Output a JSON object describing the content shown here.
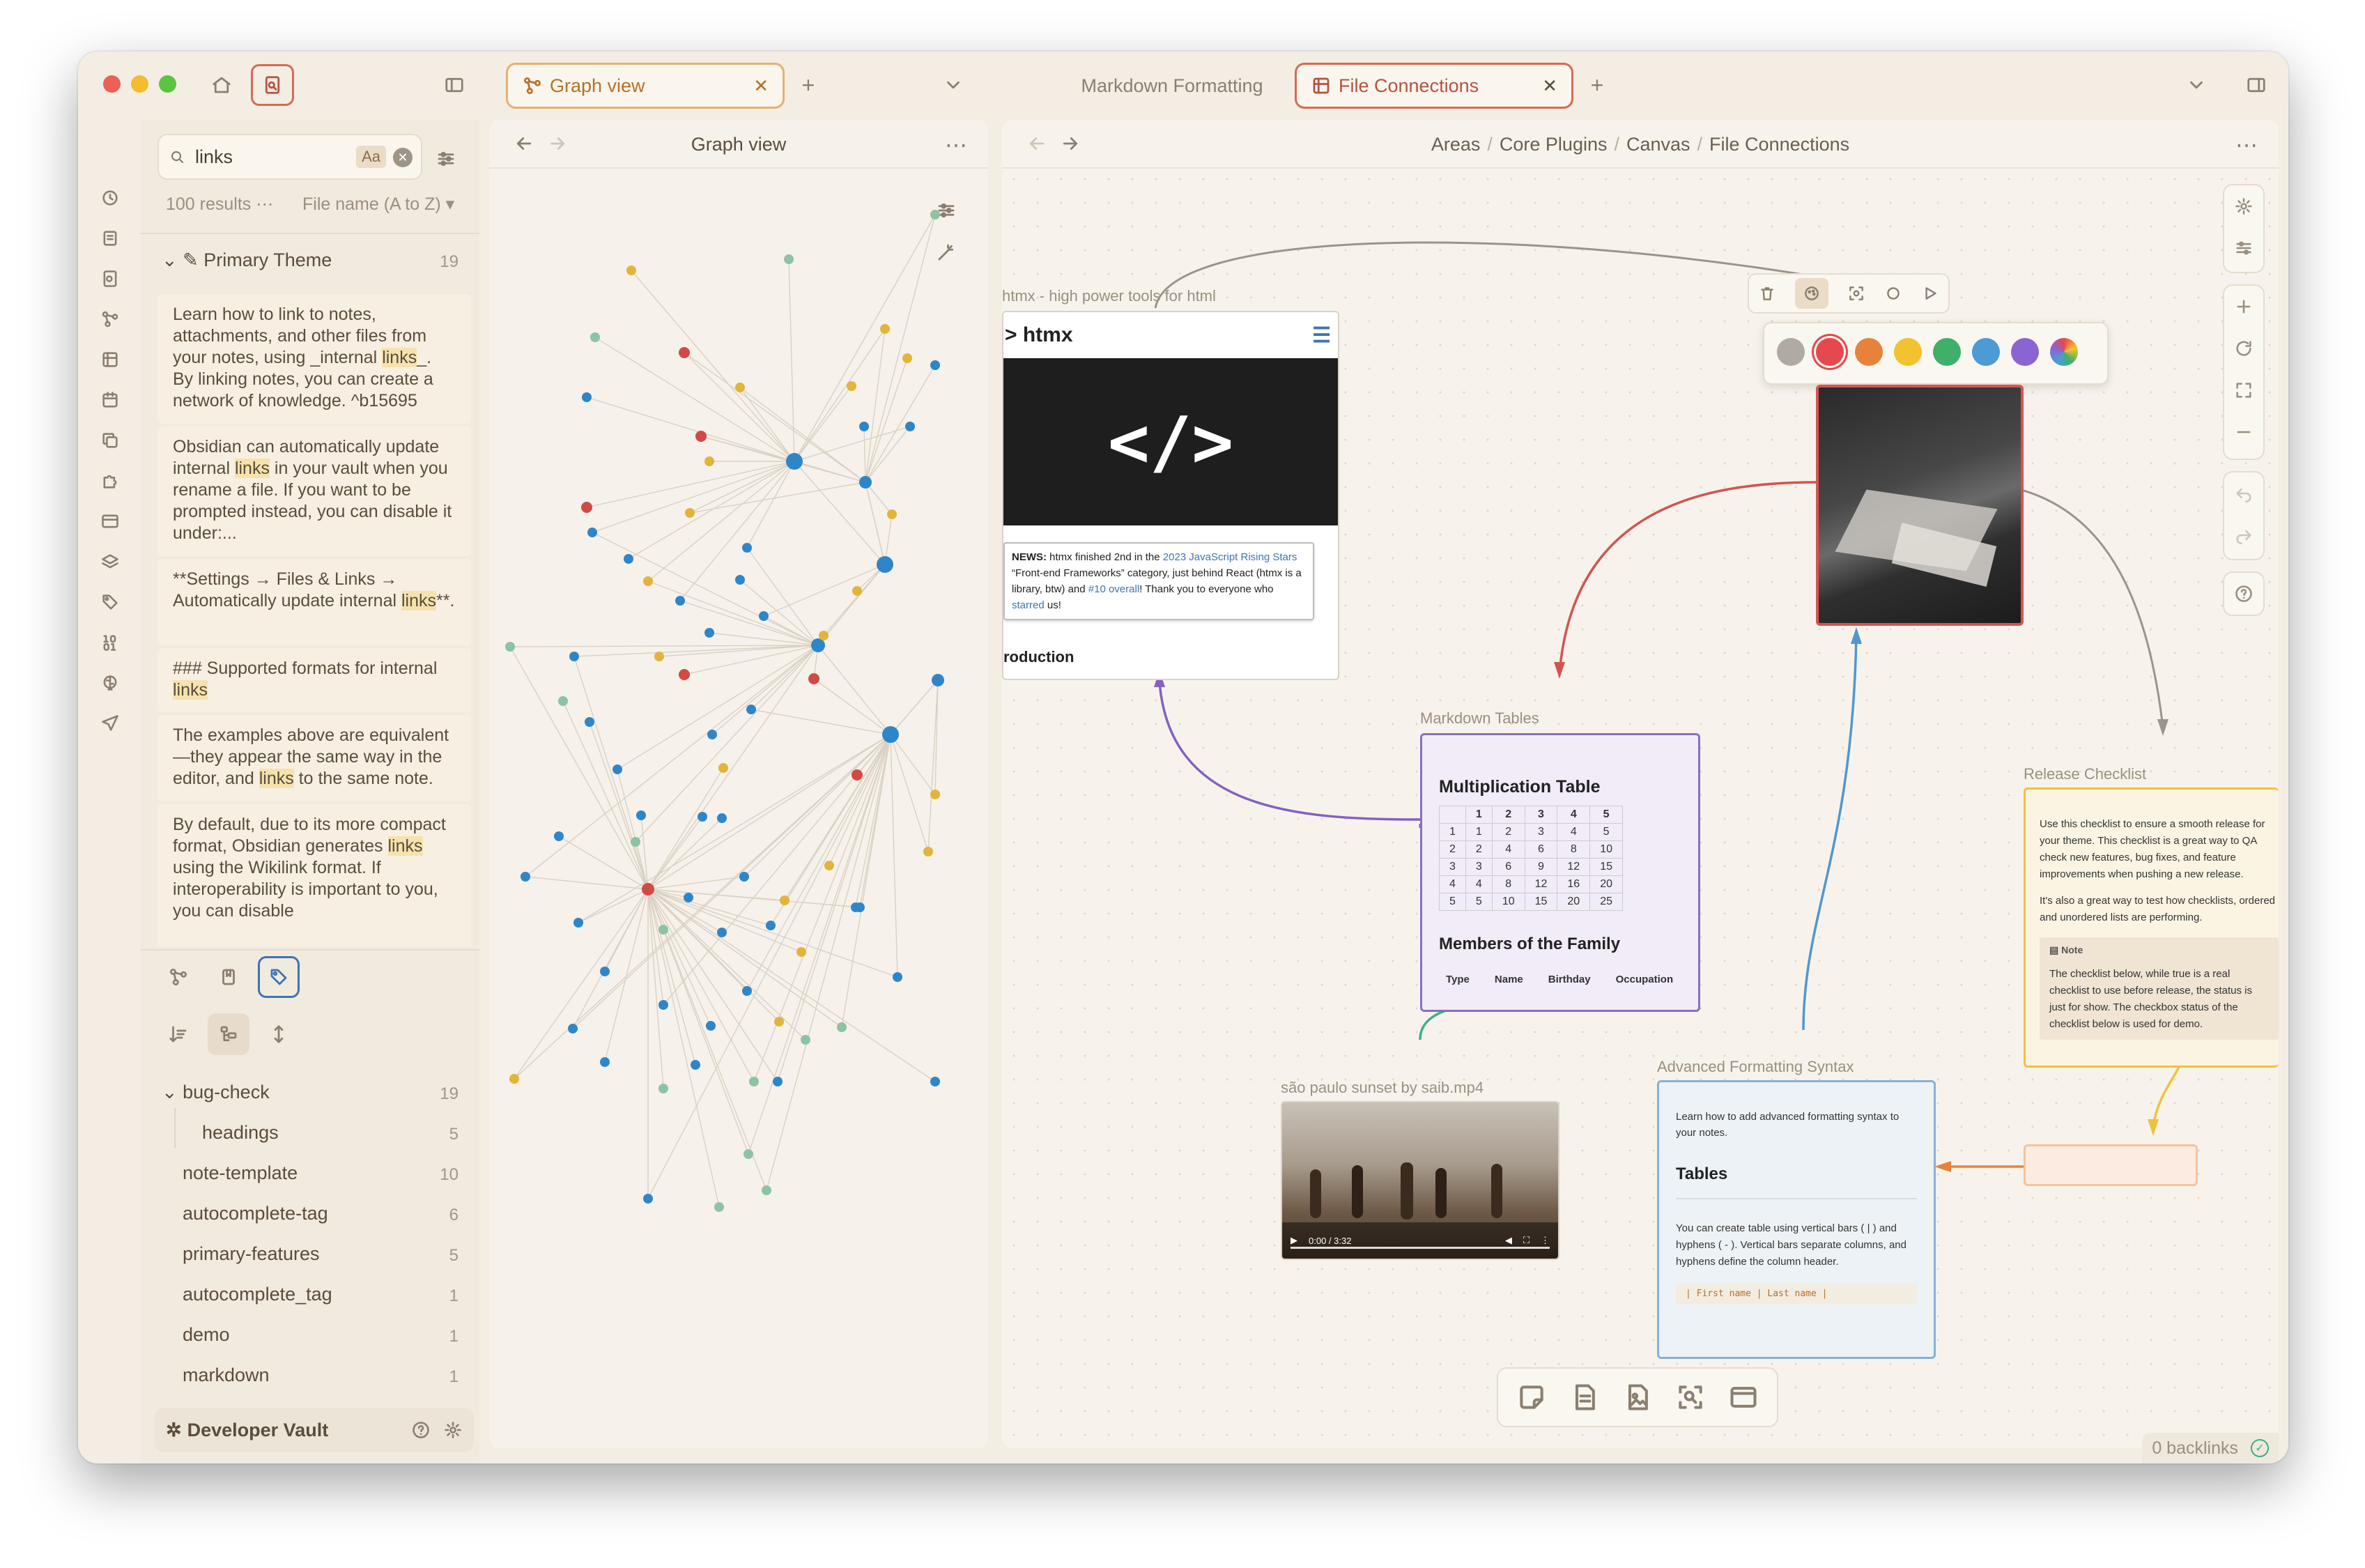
{
  "tabs": {
    "graph_label": "Graph view",
    "markdown_label": "Markdown Formatting",
    "files_label": "File Connections"
  },
  "search": {
    "query": "links",
    "case_label": "Aa",
    "results_count": "100 results",
    "sort_label": "File name (A to Z)",
    "group_title": "Primary Theme",
    "group_count": "19",
    "results": [
      {
        "before": "Learn how to link to notes, attachments, and other files from your notes, using _internal ",
        "match": "links",
        "after": "_. By linking notes, you can create a network of knowledge. ^b15695"
      },
      {
        "before": "Obsidian can automatically update internal ",
        "match": "links",
        "after": " in your vault when you rename a file. If you want to be prompted instead, you can disable it under:..."
      },
      {
        "before": "**Settings → Files & Links → Automatically update internal ",
        "match": "links",
        "after": "**."
      },
      {
        "before": "### Supported formats for internal ",
        "match": "links",
        "after": ""
      },
      {
        "before": "The examples above are equivalent—they appear the same way in the editor, and ",
        "match": "links",
        "after": " to the same note."
      },
      {
        "before": "By default, due to its more compact format, Obsidian generates ",
        "match": "links",
        "after": " using the Wikilink format. If interoperability is important to you, you can disable"
      }
    ]
  },
  "tags": [
    {
      "name": "bug-check",
      "count": "19"
    },
    {
      "name": "headings",
      "count": "5"
    },
    {
      "name": "note-template",
      "count": "10"
    },
    {
      "name": "autocomplete-tag",
      "count": "6"
    },
    {
      "name": "primary-features",
      "count": "5"
    },
    {
      "name": "autocomplete_tag",
      "count": "1"
    },
    {
      "name": "demo",
      "count": "1"
    },
    {
      "name": "markdown",
      "count": "1"
    }
  ],
  "vault": {
    "name": "Developer Vault"
  },
  "graph": {
    "title": "Graph view",
    "colors": {
      "blue": "#2e86c9",
      "yellow": "#e3b43a",
      "red": "#d24a44",
      "green": "#8cc3a4"
    }
  },
  "canvas": {
    "breadcrumb": [
      "Areas",
      "Core Plugins",
      "Canvas",
      "File Connections"
    ],
    "backlinks": "0 backlinks",
    "palette": [
      "#b0aaa2",
      "#e5484d",
      "#e8823a",
      "#f3c22f",
      "#3fb06a",
      "#4b9bd7",
      "#8b64d4"
    ],
    "htmx": {
      "label": "htmx - high power tools for html",
      "logo": "> htmx",
      "code": "</>",
      "news_bold": "NEWS:",
      "news_1": " htmx finished 2nd in the ",
      "news_link1": "2023 JavaScript Rising Stars",
      "news_2": " “Front-end Frameworks” category, just behind React (htmx is a library, btw) and ",
      "news_link2": "#10 overall",
      "news_3": "! Thank you to everyone who ",
      "news_link3": "starred",
      "news_4": " us!",
      "intro": "roduction"
    },
    "tables": {
      "label": "Markdown Tables",
      "title": "Multiplication Table",
      "header": [
        "",
        "1",
        "2",
        "3",
        "4",
        "5"
      ],
      "rows": [
        [
          "1",
          "1",
          "2",
          "3",
          "4",
          "5"
        ],
        [
          "2",
          "2",
          "4",
          "6",
          "8",
          "10"
        ],
        [
          "3",
          "3",
          "6",
          "9",
          "12",
          "15"
        ],
        [
          "4",
          "4",
          "8",
          "12",
          "16",
          "20"
        ],
        [
          "5",
          "5",
          "10",
          "15",
          "20",
          "25"
        ]
      ],
      "family_title": "Members of the Family",
      "family_cols": [
        "Type",
        "Name",
        "Birthday",
        "Occupation"
      ]
    },
    "video": {
      "label": "são paulo sunset by saib.mp4",
      "time": "0:00 / 3:32"
    },
    "advanced": {
      "label": "Advanced Formatting Syntax",
      "intro": "Learn how to add advanced formatting syntax to your notes.",
      "heading": "Tables",
      "body": "You can create table using vertical bars ( | ) and hyphens ( - ). Vertical bars separate columns, and hyphens define the column header.",
      "code": "| First name | Last name |"
    },
    "release": {
      "label": "Release Checklist",
      "p1": "Use this checklist to ensure a smooth release for your theme. This checklist is a great way to QA check new features, bug fixes, and feature improvements when pushing a new release.",
      "p2": "It's also a great way to test how checklists, ordered and unordered lists are performing.",
      "note_title": "Note",
      "note_body": "The checklist below, while true is a real checklist to use before release, the status is just for show. The checkbox status of the checklist below is used for demo."
    }
  }
}
